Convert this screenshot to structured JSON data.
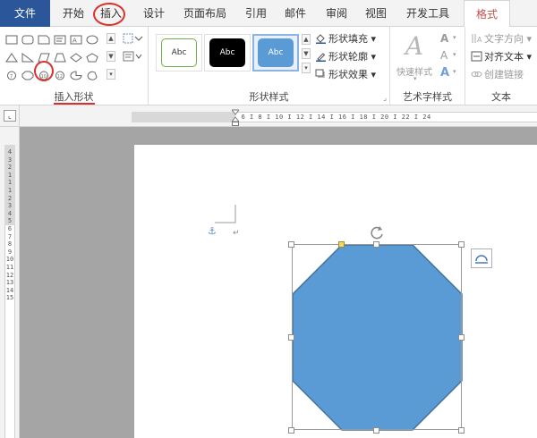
{
  "tabs": {
    "file": "文件",
    "home": "开始",
    "insert": "插入",
    "design": "设计",
    "page_layout": "页面布局",
    "references": "引用",
    "mailings": "邮件",
    "review": "审阅",
    "view": "视图",
    "developer": "开发工具",
    "format": "格式"
  },
  "ribbon": {
    "insert_shapes": {
      "label": "插入形状"
    },
    "shape_styles": {
      "label": "形状样式",
      "preset_text": "Abc",
      "fill": "形状填充",
      "outline": "形状轮廓",
      "effects": "形状效果"
    },
    "wordart": {
      "label": "艺术字样式",
      "quick_styles": "快速样式"
    },
    "text": {
      "label": "文本",
      "direction": "文字方向",
      "align": "对齐文本",
      "link": "创建链接"
    }
  },
  "ruler": {
    "horizontal": "8 I 6 I 4 I 2 I  I 2 I 4 I 6 I 8 I 10 I 12 I 14 I 16 I 18 I 20 I 22 I 24",
    "vertical": "4 3 2 1 1 1 2 3 4 5 6 7 8 9 10 11 12 13 14 15"
  },
  "colors": {
    "accent_blue": "#2b579a",
    "shape_fill": "#5b9bd5",
    "shape_stroke": "#41719c",
    "format_tab_text": "#c0504d",
    "annotation_red": "#d9302c"
  }
}
